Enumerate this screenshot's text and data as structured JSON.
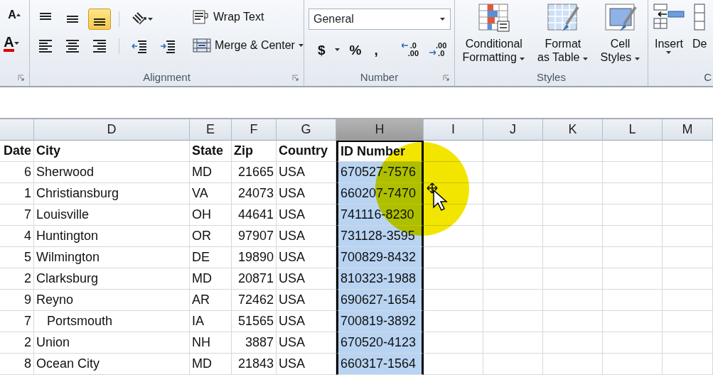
{
  "ribbon": {
    "font_group": {
      "grow_font": "A",
      "font_color": "A"
    },
    "alignment": {
      "label": "Alignment",
      "vertical": [
        {
          "kind": "top",
          "selected": false
        },
        {
          "kind": "middle",
          "selected": false
        },
        {
          "kind": "bottom",
          "selected": true
        }
      ],
      "horizontal": [
        {
          "kind": "left",
          "selected": false
        },
        {
          "kind": "center",
          "selected": false
        },
        {
          "kind": "right",
          "selected": false
        }
      ],
      "wrap_text": "Wrap Text",
      "merge_center": "Merge & Center"
    },
    "number": {
      "label": "Number",
      "format": "General",
      "symbols": [
        "$",
        "%",
        ","
      ],
      "increase_decimal": [
        ".0",
        ".00"
      ],
      "decrease_decimal": [
        ".00",
        ".0"
      ]
    },
    "styles": {
      "label": "Styles",
      "buttons": [
        {
          "kind": "conditional",
          "lines": [
            "Conditional",
            "Formatting"
          ]
        },
        {
          "kind": "table",
          "lines": [
            "Format",
            "as Table"
          ]
        },
        {
          "kind": "cell-styles",
          "lines": [
            "Cell",
            "Styles"
          ]
        }
      ]
    },
    "cells": {
      "label": "C",
      "buttons": [
        {
          "kind": "insert",
          "label": "Insert"
        },
        {
          "kind": "delete",
          "label": "De"
        }
      ]
    }
  },
  "sheet": {
    "columns": [
      {
        "selected": false
      },
      {
        "letter": "D",
        "selected": false
      },
      {
        "letter": "E",
        "selected": false
      },
      {
        "letter": "F",
        "selected": false
      },
      {
        "letter": "G",
        "selected": false
      },
      {
        "letter": "H",
        "selected": true
      },
      {
        "letter": "I",
        "selected": false
      },
      {
        "letter": "J",
        "selected": false
      },
      {
        "letter": "K",
        "selected": false
      },
      {
        "letter": "L",
        "selected": false
      },
      {
        "letter": "M",
        "selected": false
      }
    ],
    "rows": [
      {
        "header": true,
        "cells": [
          "Date",
          "City",
          "State",
          "Zip",
          "Country",
          "ID Number"
        ]
      },
      {
        "header": false,
        "cells": [
          "6",
          "Sherwood",
          "MD",
          "21665",
          "USA",
          "670527-7576"
        ]
      },
      {
        "header": false,
        "cells": [
          "1",
          "Christiansburg",
          "VA",
          "24073",
          "USA",
          "660207-7470"
        ]
      },
      {
        "header": false,
        "cells": [
          "7",
          "Louisville",
          "OH",
          "44641",
          "USA",
          "741116-8230"
        ]
      },
      {
        "header": false,
        "cells": [
          "4",
          "Huntington",
          "OR",
          "97907",
          "USA",
          "731128-3595"
        ]
      },
      {
        "header": false,
        "cells": [
          "5",
          "Wilmington",
          "DE",
          "19890",
          "USA",
          "700829-8432"
        ]
      },
      {
        "header": false,
        "cells": [
          "2",
          "Clarksburg",
          "MD",
          "20871",
          "USA",
          "810323-1988"
        ]
      },
      {
        "header": false,
        "cells": [
          "9",
          "Reyno",
          "AR",
          "72462",
          "USA",
          "690627-1654"
        ]
      },
      {
        "header": false,
        "cells": [
          "7",
          "   Portsmouth",
          "IA",
          "51565",
          "USA",
          "700819-3892"
        ]
      },
      {
        "header": false,
        "cells": [
          "2",
          "Union",
          "NH",
          "3887",
          "USA",
          "670520-4123"
        ]
      },
      {
        "header": false,
        "cells": [
          "8",
          "Ocean City",
          "MD",
          "21843",
          "USA",
          "660317-1564"
        ]
      }
    ]
  }
}
